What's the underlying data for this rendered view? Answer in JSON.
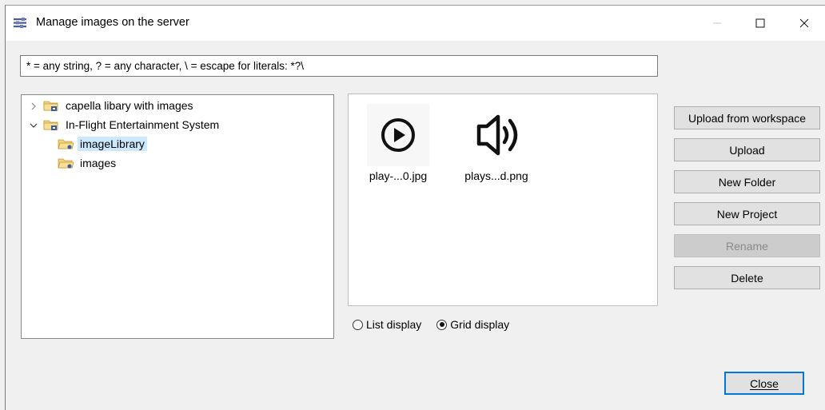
{
  "window": {
    "title": "Manage images on the server"
  },
  "filter": {
    "placeholder": "* = any string, ? = any character, \\ = escape for literals: *?\\"
  },
  "tree": {
    "items": [
      {
        "label": "capella libary with images",
        "expanded": false
      },
      {
        "label": "In-Flight Entertainment System",
        "expanded": true
      },
      {
        "label": "imageLibrary",
        "selected": true
      },
      {
        "label": "images"
      }
    ]
  },
  "grid": {
    "items": [
      {
        "caption": "play-...0.jpg",
        "icon": "play-circle-icon"
      },
      {
        "caption": "plays...d.png",
        "icon": "speaker-icon"
      }
    ]
  },
  "display_mode": {
    "list_label": "List display",
    "grid_label": "Grid display",
    "selected": "Grid display"
  },
  "actions": {
    "upload_from_workspace": "Upload from workspace",
    "upload": "Upload",
    "new_folder": "New Folder",
    "new_project": "New Project",
    "rename": "Rename",
    "delete": "Delete"
  },
  "footer": {
    "close_label": "Close"
  },
  "colors": {
    "selection": "#cce8ff",
    "focus_border": "#0078d7",
    "dialog_background": "#f0f0f0"
  }
}
